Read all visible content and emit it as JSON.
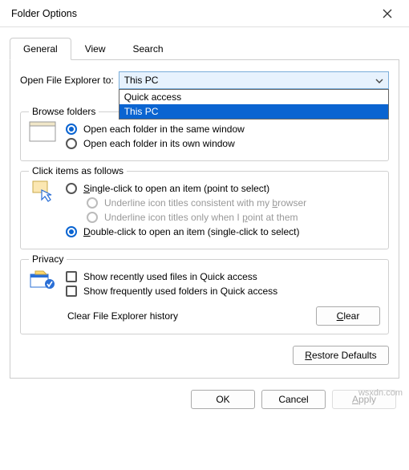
{
  "window": {
    "title": "Folder Options"
  },
  "tabs": {
    "general": "General",
    "view": "View",
    "search": "Search"
  },
  "openExplorer": {
    "label": "Open File Explorer to:",
    "selected": "This PC",
    "options": [
      "Quick access",
      "This PC"
    ],
    "highlighted": "This PC"
  },
  "browseFolders": {
    "title": "Browse folders",
    "same": "Open each folder in the same window",
    "own": "Open each folder in its own window"
  },
  "clickItems": {
    "title": "Click items as follows",
    "single": "Single-click to open an item (point to select)",
    "underlineBrowser": "Underline icon titles consistent with my browser",
    "underlinePoint": "Underline icon titles only when I point at them",
    "double": "Double-click to open an item (single-click to select)"
  },
  "privacy": {
    "title": "Privacy",
    "recentFiles": "Show recently used files in Quick access",
    "frequentFolders": "Show frequently used folders in Quick access",
    "clearLabel": "Clear File Explorer history",
    "clearButton": "Clear"
  },
  "restore": "Restore Defaults",
  "footer": {
    "ok": "OK",
    "cancel": "Cancel",
    "apply": "Apply"
  },
  "watermark": "wsxdn.com"
}
